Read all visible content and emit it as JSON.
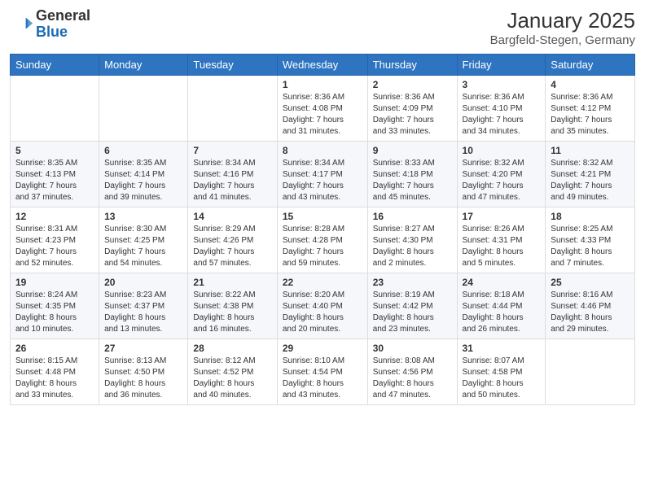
{
  "logo": {
    "general": "General",
    "blue": "Blue"
  },
  "header": {
    "month": "January 2025",
    "location": "Bargfeld-Stegen, Germany"
  },
  "weekdays": [
    "Sunday",
    "Monday",
    "Tuesday",
    "Wednesday",
    "Thursday",
    "Friday",
    "Saturday"
  ],
  "weeks": [
    [
      {
        "day": "",
        "info": ""
      },
      {
        "day": "",
        "info": ""
      },
      {
        "day": "",
        "info": ""
      },
      {
        "day": "1",
        "info": "Sunrise: 8:36 AM\nSunset: 4:08 PM\nDaylight: 7 hours\nand 31 minutes."
      },
      {
        "day": "2",
        "info": "Sunrise: 8:36 AM\nSunset: 4:09 PM\nDaylight: 7 hours\nand 33 minutes."
      },
      {
        "day": "3",
        "info": "Sunrise: 8:36 AM\nSunset: 4:10 PM\nDaylight: 7 hours\nand 34 minutes."
      },
      {
        "day": "4",
        "info": "Sunrise: 8:36 AM\nSunset: 4:12 PM\nDaylight: 7 hours\nand 35 minutes."
      }
    ],
    [
      {
        "day": "5",
        "info": "Sunrise: 8:35 AM\nSunset: 4:13 PM\nDaylight: 7 hours\nand 37 minutes."
      },
      {
        "day": "6",
        "info": "Sunrise: 8:35 AM\nSunset: 4:14 PM\nDaylight: 7 hours\nand 39 minutes."
      },
      {
        "day": "7",
        "info": "Sunrise: 8:34 AM\nSunset: 4:16 PM\nDaylight: 7 hours\nand 41 minutes."
      },
      {
        "day": "8",
        "info": "Sunrise: 8:34 AM\nSunset: 4:17 PM\nDaylight: 7 hours\nand 43 minutes."
      },
      {
        "day": "9",
        "info": "Sunrise: 8:33 AM\nSunset: 4:18 PM\nDaylight: 7 hours\nand 45 minutes."
      },
      {
        "day": "10",
        "info": "Sunrise: 8:32 AM\nSunset: 4:20 PM\nDaylight: 7 hours\nand 47 minutes."
      },
      {
        "day": "11",
        "info": "Sunrise: 8:32 AM\nSunset: 4:21 PM\nDaylight: 7 hours\nand 49 minutes."
      }
    ],
    [
      {
        "day": "12",
        "info": "Sunrise: 8:31 AM\nSunset: 4:23 PM\nDaylight: 7 hours\nand 52 minutes."
      },
      {
        "day": "13",
        "info": "Sunrise: 8:30 AM\nSunset: 4:25 PM\nDaylight: 7 hours\nand 54 minutes."
      },
      {
        "day": "14",
        "info": "Sunrise: 8:29 AM\nSunset: 4:26 PM\nDaylight: 7 hours\nand 57 minutes."
      },
      {
        "day": "15",
        "info": "Sunrise: 8:28 AM\nSunset: 4:28 PM\nDaylight: 7 hours\nand 59 minutes."
      },
      {
        "day": "16",
        "info": "Sunrise: 8:27 AM\nSunset: 4:30 PM\nDaylight: 8 hours\nand 2 minutes."
      },
      {
        "day": "17",
        "info": "Sunrise: 8:26 AM\nSunset: 4:31 PM\nDaylight: 8 hours\nand 5 minutes."
      },
      {
        "day": "18",
        "info": "Sunrise: 8:25 AM\nSunset: 4:33 PM\nDaylight: 8 hours\nand 7 minutes."
      }
    ],
    [
      {
        "day": "19",
        "info": "Sunrise: 8:24 AM\nSunset: 4:35 PM\nDaylight: 8 hours\nand 10 minutes."
      },
      {
        "day": "20",
        "info": "Sunrise: 8:23 AM\nSunset: 4:37 PM\nDaylight: 8 hours\nand 13 minutes."
      },
      {
        "day": "21",
        "info": "Sunrise: 8:22 AM\nSunset: 4:38 PM\nDaylight: 8 hours\nand 16 minutes."
      },
      {
        "day": "22",
        "info": "Sunrise: 8:20 AM\nSunset: 4:40 PM\nDaylight: 8 hours\nand 20 minutes."
      },
      {
        "day": "23",
        "info": "Sunrise: 8:19 AM\nSunset: 4:42 PM\nDaylight: 8 hours\nand 23 minutes."
      },
      {
        "day": "24",
        "info": "Sunrise: 8:18 AM\nSunset: 4:44 PM\nDaylight: 8 hours\nand 26 minutes."
      },
      {
        "day": "25",
        "info": "Sunrise: 8:16 AM\nSunset: 4:46 PM\nDaylight: 8 hours\nand 29 minutes."
      }
    ],
    [
      {
        "day": "26",
        "info": "Sunrise: 8:15 AM\nSunset: 4:48 PM\nDaylight: 8 hours\nand 33 minutes."
      },
      {
        "day": "27",
        "info": "Sunrise: 8:13 AM\nSunset: 4:50 PM\nDaylight: 8 hours\nand 36 minutes."
      },
      {
        "day": "28",
        "info": "Sunrise: 8:12 AM\nSunset: 4:52 PM\nDaylight: 8 hours\nand 40 minutes."
      },
      {
        "day": "29",
        "info": "Sunrise: 8:10 AM\nSunset: 4:54 PM\nDaylight: 8 hours\nand 43 minutes."
      },
      {
        "day": "30",
        "info": "Sunrise: 8:08 AM\nSunset: 4:56 PM\nDaylight: 8 hours\nand 47 minutes."
      },
      {
        "day": "31",
        "info": "Sunrise: 8:07 AM\nSunset: 4:58 PM\nDaylight: 8 hours\nand 50 minutes."
      },
      {
        "day": "",
        "info": ""
      }
    ]
  ]
}
